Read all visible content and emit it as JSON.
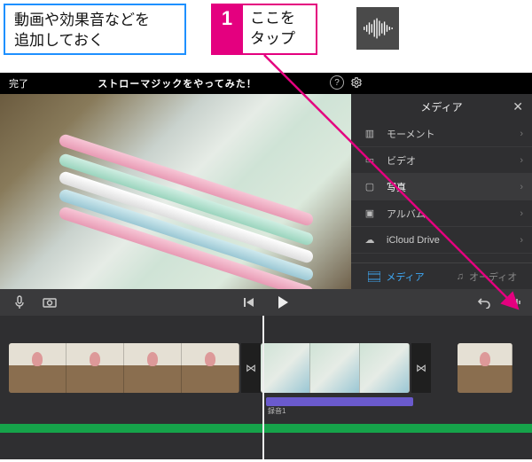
{
  "annotation": {
    "note_box": "動画や効果音などを\n追加しておく",
    "step_number": "1",
    "step_text": "ここを\nタップ"
  },
  "titlebar": {
    "done_label": "完了",
    "project_title": "ストローマジックをやってみた！"
  },
  "media_panel": {
    "title": "メディア",
    "items": [
      {
        "label": "モーメント",
        "icon": "moments"
      },
      {
        "label": "ビデオ",
        "icon": "video"
      },
      {
        "label": "写真",
        "icon": "photo",
        "selected": true
      },
      {
        "label": "アルバム",
        "icon": "album"
      },
      {
        "label": "iCloud Drive",
        "icon": "cloud"
      }
    ],
    "tabs": {
      "media": "メディア",
      "audio": "オーディオ"
    }
  },
  "timeline": {
    "audio_clip_label": "録音1"
  }
}
